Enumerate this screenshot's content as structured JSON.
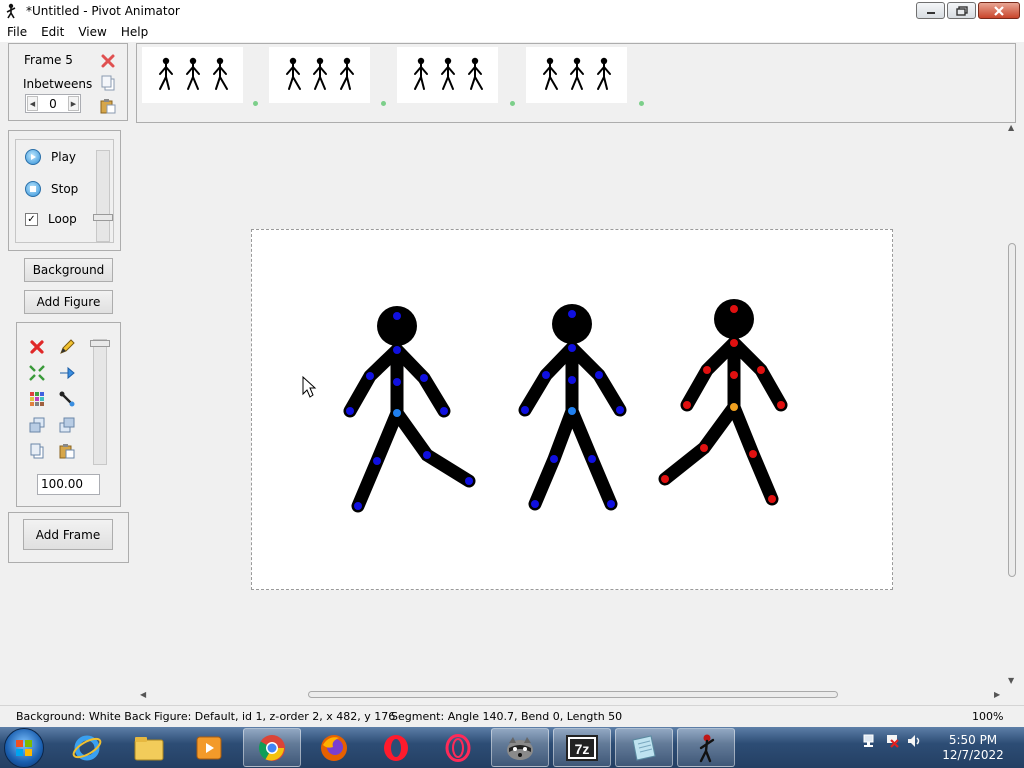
{
  "window": {
    "title": "*Untitled - Pivot Animator"
  },
  "menu": {
    "items": [
      "File",
      "Edit",
      "View",
      "Help"
    ]
  },
  "frame_panel": {
    "frame_label": "Frame 5",
    "inbetweens_label": "Inbetweens",
    "inbetweens_value": "0"
  },
  "playback": {
    "play_label": "Play",
    "stop_label": "Stop",
    "loop_label": "Loop",
    "loop_checked": true
  },
  "buttons": {
    "background": "Background",
    "add_figure": "Add Figure",
    "add_frame": "Add Frame"
  },
  "tools": {
    "scale_value": "100.00"
  },
  "timeline": {
    "frames": 4,
    "figures_per_frame": 3
  },
  "status": {
    "background": "Background: White Back",
    "figure": "Figure: Default,  id 1,  z-order 2,  x 482, y 176",
    "segment": "Segment: Angle 140.7,  Bend 0,  Length 50",
    "zoom": "100%"
  },
  "taskbar": {
    "apps": [
      "internet-explorer",
      "file-explorer",
      "media-player",
      "chrome",
      "firefox",
      "opera",
      "opera-gx",
      "raccoon-app",
      "7zip",
      "notepad",
      "pivot-animator"
    ],
    "time": "5:50 PM",
    "date": "12/7/2022"
  },
  "colors": {
    "joint_blue": "#1010e0",
    "joint_red": "#e01010",
    "joint_orange": "#f0a020",
    "joint_lightblue": "#2080f0"
  }
}
